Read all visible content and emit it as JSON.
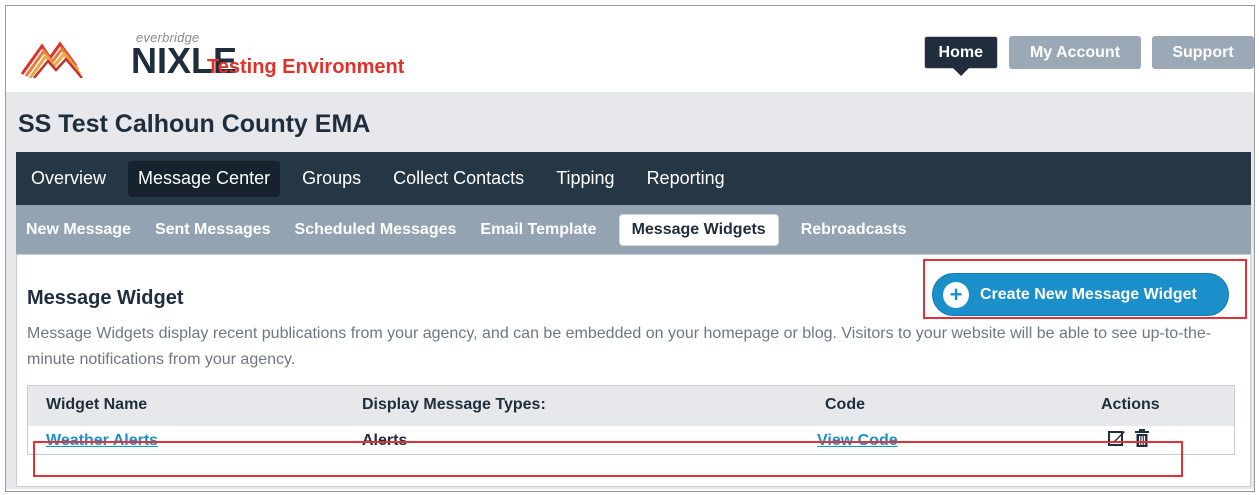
{
  "header": {
    "brand_small": "everbridge",
    "brand_name": "NIXLE",
    "environment_label": "Testing Environment",
    "top_nav": [
      {
        "label": "Home",
        "active": true
      },
      {
        "label": "My Account",
        "active": false
      },
      {
        "label": "Support",
        "active": false
      }
    ]
  },
  "agency": {
    "title": "SS Test Calhoun County EMA"
  },
  "main_nav": {
    "tabs": [
      {
        "label": "Overview",
        "active": false
      },
      {
        "label": "Message Center",
        "active": true
      },
      {
        "label": "Groups",
        "active": false
      },
      {
        "label": "Collect Contacts",
        "active": false
      },
      {
        "label": "Tipping",
        "active": false
      },
      {
        "label": "Reporting",
        "active": false
      }
    ]
  },
  "sub_nav": {
    "tabs": [
      {
        "label": "New Message",
        "active": false
      },
      {
        "label": "Sent Messages",
        "active": false
      },
      {
        "label": "Scheduled Messages",
        "active": false
      },
      {
        "label": "Email Template",
        "active": false
      },
      {
        "label": "Message Widgets",
        "active": true
      },
      {
        "label": "Rebroadcasts",
        "active": false
      }
    ]
  },
  "content": {
    "title": "Message Widget",
    "description": "Message Widgets display recent publications from your agency, and can be embedded on your homepage or blog. Visitors to your website will be able to see up-to-the-minute notifications from your agency.",
    "create_button": "Create New Message Widget",
    "table": {
      "columns": [
        "Widget Name",
        "Display Message Types:",
        "Code",
        "Actions"
      ],
      "rows": [
        {
          "name": "Weather Alerts",
          "types": "Alerts",
          "code": "View Code",
          "actions": [
            "edit-icon",
            "trash-icon"
          ]
        }
      ]
    }
  },
  "colors": {
    "accent_blue": "#1a8fc9",
    "nav_dark": "#253644",
    "subnav": "#93a3b2",
    "highlight_red": "#e0323a",
    "env_red": "#e0322a"
  }
}
